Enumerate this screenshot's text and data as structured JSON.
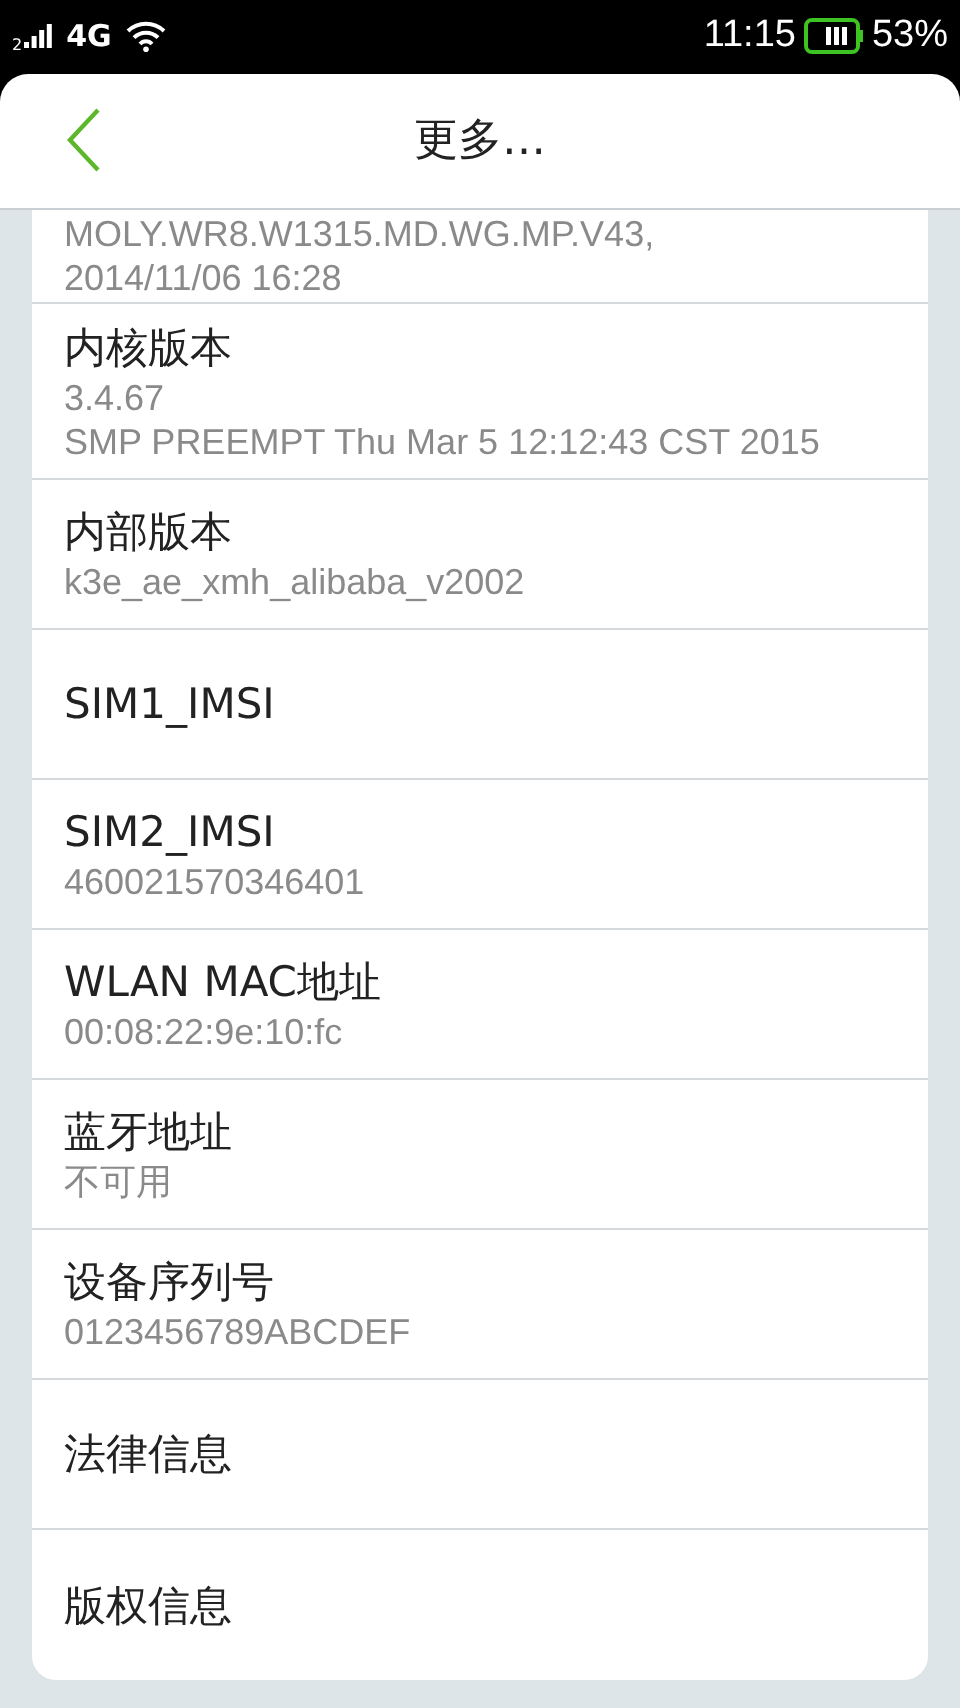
{
  "status_bar": {
    "sim_slot": "2",
    "network": "4G",
    "time": "11:15",
    "battery_percent": "53%"
  },
  "header": {
    "title": "更多…"
  },
  "items": [
    {
      "values": [
        "MOLY.WR8.W1315.MD.WG.MP.V43,",
        "2014/11/06 16:28"
      ]
    },
    {
      "title": "内核版本",
      "values": [
        "3.4.67",
        "SMP PREEMPT Thu Mar 5 12:12:43 CST 2015"
      ]
    },
    {
      "title": "内部版本",
      "values": [
        "k3e_ae_xmh_alibaba_v2002"
      ]
    },
    {
      "title": "SIM1_IMSI"
    },
    {
      "title": "SIM2_IMSI",
      "values": [
        "460021570346401"
      ]
    },
    {
      "title": "WLAN MAC地址",
      "values": [
        "00:08:22:9e:10:fc"
      ]
    },
    {
      "title": "蓝牙地址",
      "values": [
        "不可用"
      ]
    },
    {
      "title": "设备序列号",
      "values": [
        "0123456789ABCDEF"
      ]
    },
    {
      "title": "法律信息"
    },
    {
      "title": "版权信息"
    }
  ]
}
